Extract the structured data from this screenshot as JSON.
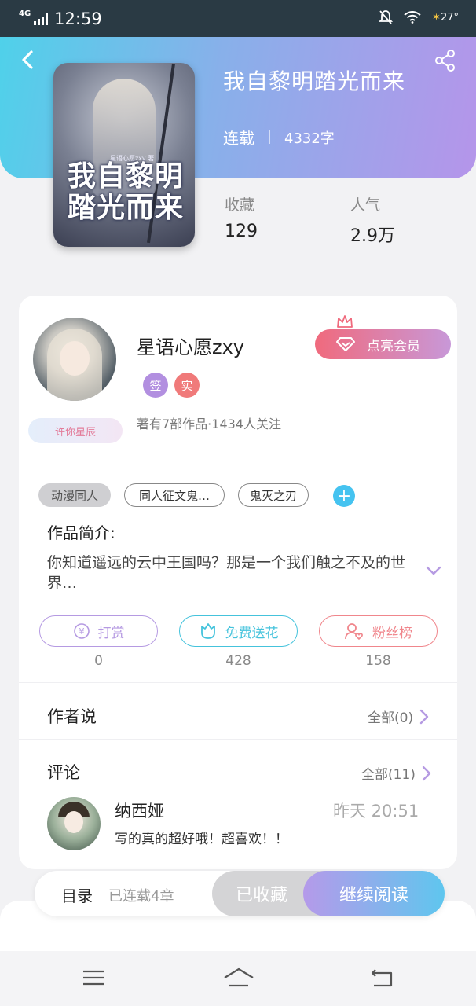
{
  "status_bar": {
    "network": "4G",
    "time": "12:59",
    "temperature": "27°"
  },
  "book": {
    "title": "我自黎明踏光而来",
    "status": "连载",
    "word_count": "4332字",
    "cover_title": "我自黎明踏光而来",
    "cover_author": "星语心愿zxy 著",
    "favorites_label": "收藏",
    "favorites_value": "129",
    "popularity_label": "人气",
    "popularity_value": "2.9万"
  },
  "author": {
    "name": "星语心愿zxy",
    "vip_label": "点亮会员",
    "badge_sign": "签",
    "badge_real": "实",
    "fan_tag": "许你星辰",
    "info": "著有7部作品·1434人关注"
  },
  "tags": [
    "动漫同人",
    "同人征文鬼…",
    "鬼灭之刃"
  ],
  "intro": {
    "label": "作品简介:",
    "text": "你知道遥远的云中王国吗？那是一个我们触之不及的世界…"
  },
  "actions": [
    {
      "label": "打赏",
      "count": "0",
      "color": "#b59ae2"
    },
    {
      "label": "免费送花",
      "count": "428",
      "color": "#45c3dc"
    },
    {
      "label": "粉丝榜",
      "count": "158",
      "color": "#f0868c"
    }
  ],
  "author_says": {
    "title": "作者说",
    "link": "全部(0)"
  },
  "comments": {
    "title": "评论",
    "link": "全部(11)",
    "items": [
      {
        "user": "纳西娅",
        "time": "昨天 20:51",
        "text": "写的真的超好哦！超喜欢！！"
      }
    ]
  },
  "bottom_bar": {
    "toc_label": "目录",
    "toc_sub": "已连载4章",
    "collected_label": "已收藏",
    "read_label": "继续阅读"
  },
  "colors": {
    "accent_purple": "#b59aea",
    "accent_cyan": "#4fd1ea",
    "vip_pink": "#f06a7d"
  }
}
